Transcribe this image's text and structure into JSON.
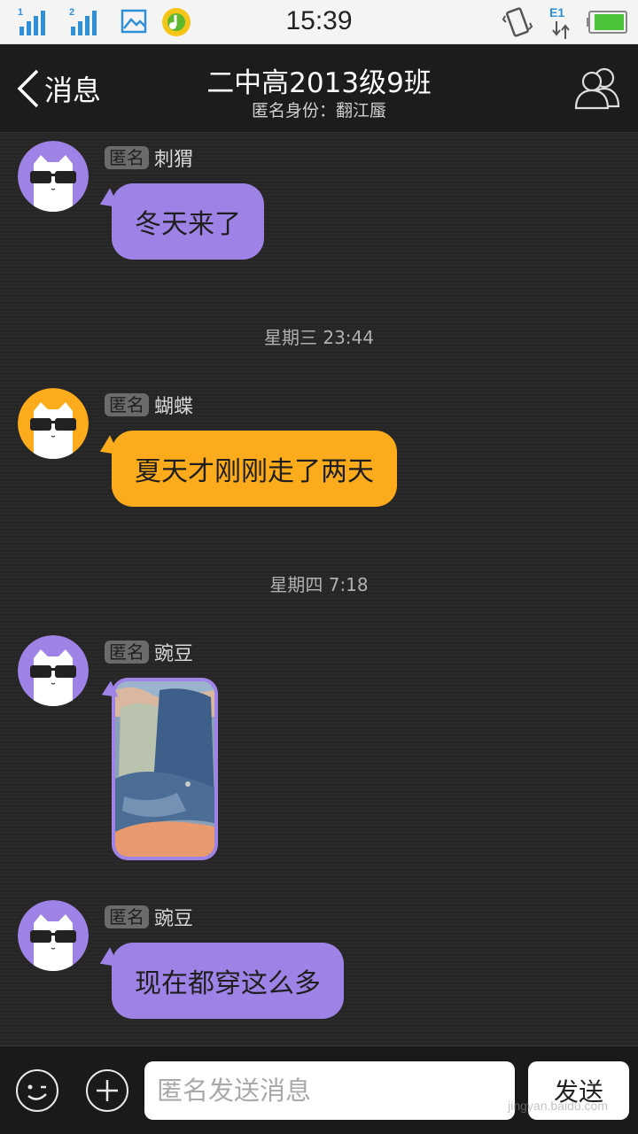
{
  "status_bar": {
    "time": "15:39",
    "sim1_label": "1",
    "sim2_label": "2",
    "network_label": "E1"
  },
  "header": {
    "back_label": "消息",
    "title": "二中高2013级9班",
    "subtitle": "匿名身份：翻江蜃"
  },
  "colors": {
    "purple": "#9f82e6",
    "orange": "#fbab1c",
    "chat_bg": "#262626",
    "header_bg": "#1c1c1c"
  },
  "messages": [
    {
      "anon_tag": "匿名",
      "nickname": "刺猬",
      "text": "冬天来了",
      "avatar_color": "purple"
    },
    {
      "anon_tag": "匿名",
      "nickname": "蝴蝶",
      "text": "夏天才刚刚走了两天",
      "avatar_color": "orange"
    },
    {
      "anon_tag": "匿名",
      "nickname": "豌豆",
      "type": "image",
      "avatar_color": "purple"
    },
    {
      "anon_tag": "匿名",
      "nickname": "豌豆",
      "text": "现在都穿这么多",
      "avatar_color": "purple"
    }
  ],
  "timestamps": [
    "星期三 23:44",
    "星期四 7:18"
  ],
  "input_bar": {
    "placeholder": "匿名发送消息",
    "send_label": "发送"
  },
  "watermark": "jingyan.baidu.com",
  "icons": [
    "signal-sim1-icon",
    "signal-sim2-icon",
    "gallery-notification-icon",
    "music-app-icon",
    "vibrate-icon",
    "data-transfer-icon",
    "battery-icon",
    "back-chevron-icon",
    "group-members-icon",
    "emoji-icon",
    "plus-icon"
  ]
}
